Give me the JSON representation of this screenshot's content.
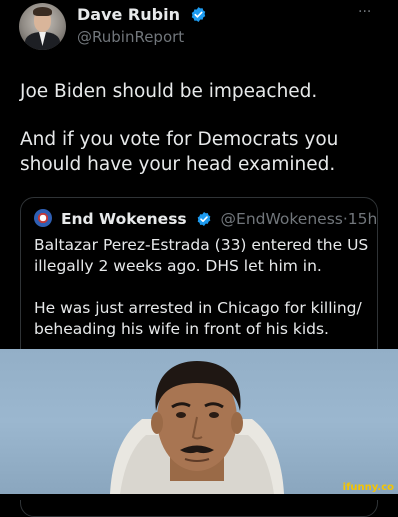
{
  "author": {
    "display_name": "Dave Rubin",
    "handle": "@RubinReport",
    "avatar_icon": "profile-photo",
    "verified_icon": "verified-badge-icon",
    "verified_color": "#1d9bf0"
  },
  "more_label": "···",
  "tweet_text": {
    "line1": "Joe Biden should be impeached.",
    "line2": "And if you vote for Democrats you should have your head examined."
  },
  "quote": {
    "display_name": "End Wokeness",
    "handle": "@EndWokeness",
    "separator": "·",
    "time": "15h",
    "text_line1": "Baltazar Perez-Estrada (33) entered the US illegally 2 weeks ago. DHS let him in.",
    "text_line2": "He was just arrested in Chicago for killing/ beheading his wife in front of his kids."
  },
  "watermark": "ifunny.co",
  "colors": {
    "background": "#000000",
    "text_primary": "#e7e9ea",
    "text_secondary": "#71767b",
    "border": "#2f3336",
    "watermark": "#f5c400"
  }
}
